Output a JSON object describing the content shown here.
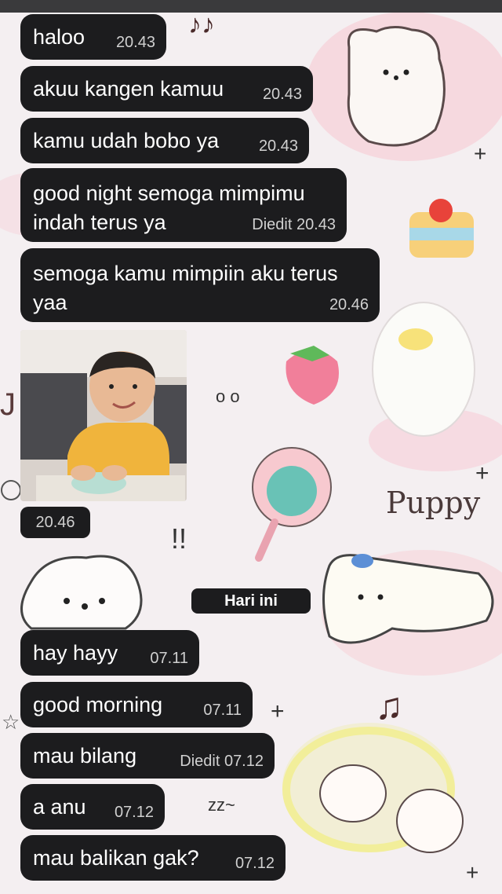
{
  "wallpaper": {
    "label": "Puppy"
  },
  "messages": [
    {
      "text": "haloo",
      "time": "20.43"
    },
    {
      "text": "akuu kangen kamuu",
      "time": "20.43"
    },
    {
      "text": "kamu udah bobo ya",
      "time": "20.43"
    },
    {
      "text": "good night semoga mimpimu\nindah terus ya",
      "time": "Diedit 20.43"
    },
    {
      "text": "semoga kamu mimpiin aku terus\nyaa",
      "time": "20.46"
    }
  ],
  "photo_message": {
    "time": "20.46"
  },
  "date_separator": "Hari ini",
  "messages_today": [
    {
      "text": "hay hayy",
      "time": "07.11"
    },
    {
      "text": "good morning",
      "time": "07.11"
    },
    {
      "text": "mau bilang",
      "time": "Diedit 07.12"
    },
    {
      "text": "a anu",
      "time": "07.12"
    },
    {
      "text": "mau balikan gak?",
      "time": "07.12"
    }
  ],
  "colors": {
    "bubble": "#1c1c1e",
    "wallpaper": "#f3eef0",
    "accent_pink": "#f5b7c5"
  }
}
